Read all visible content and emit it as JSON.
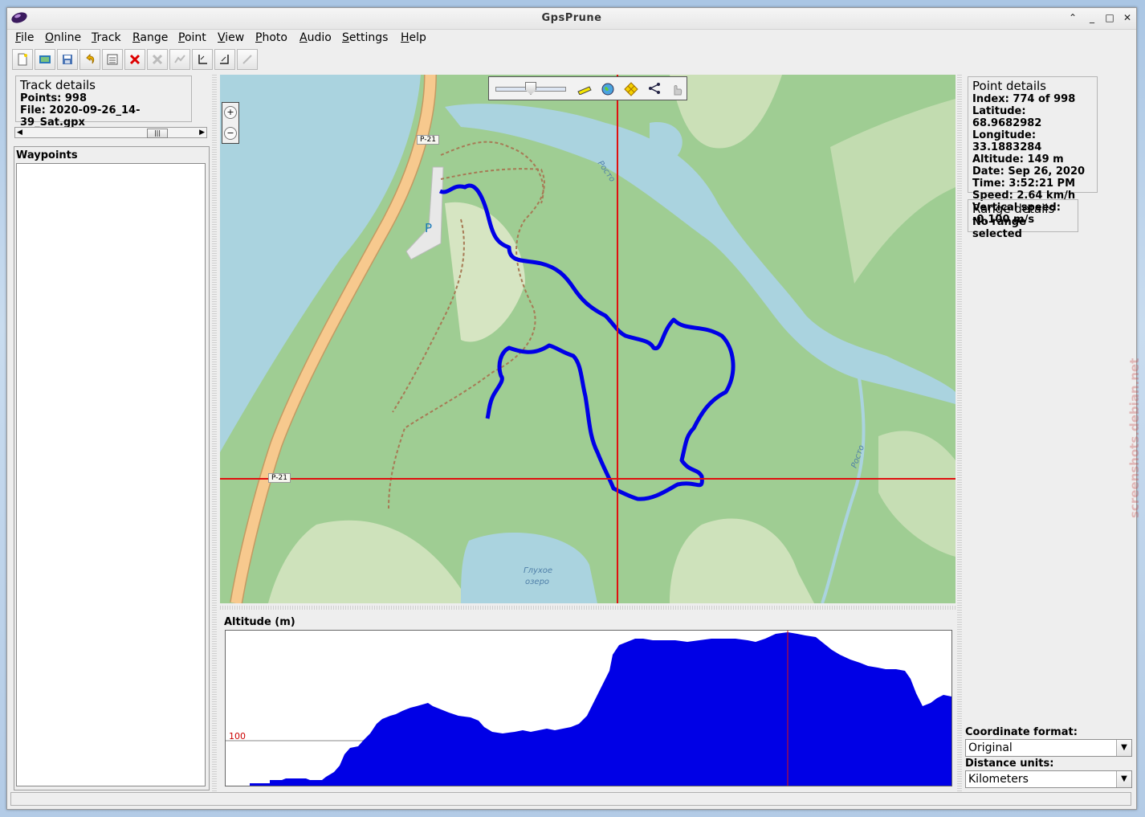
{
  "window": {
    "title": "GpsPrune"
  },
  "menu": [
    "File",
    "Online",
    "Track",
    "Range",
    "Point",
    "View",
    "Photo",
    "Audio",
    "Settings",
    "Help"
  ],
  "toolbar": {
    "icons": [
      "new-icon",
      "open-icon",
      "save-icon",
      "undo-icon",
      "edit-icon",
      "delete-icon",
      "delete-disabled-icon",
      "compress-icon",
      "range-start-icon",
      "range-end-icon",
      "connect-icon"
    ]
  },
  "track_details": {
    "title": "Track details",
    "points": "Points: 998",
    "file": "File: 2020-09-26_14-39_Sat.gpx"
  },
  "waypoints": {
    "title": "Waypoints"
  },
  "map": {
    "labels": {
      "road1": "P-21",
      "road2": "P-21",
      "river1": "Росто",
      "river2": "Росто",
      "lake_line1": "Глухое",
      "lake_line2": "озеро",
      "parking": "P"
    }
  },
  "altitude": {
    "label": "Altitude (m)",
    "tick": "100"
  },
  "point_details": {
    "title": "Point details",
    "index": "Index: 774 of 998",
    "latitude": "Latitude: 68.9682982",
    "longitude": "Longitude: 33.1883284",
    "altitude": "Altitude: 149 m",
    "date": "Date: Sep 26, 2020",
    "time": "Time: 3:52:21 PM",
    "speed": "Speed: 2.64 km/h",
    "vspeed": "Vertical speed: -0.100 m/s"
  },
  "range_details": {
    "title": "Range details",
    "value": "No range selected"
  },
  "coord_format": {
    "label": "Coordinate format:",
    "value": "Original"
  },
  "distance_units": {
    "label": "Distance units:",
    "value": "Kilometers"
  },
  "watermark": "screenshots.debian.net",
  "colors": {
    "track": "#0000e6",
    "crosshair": "#e01010",
    "water": "#aad3df",
    "forest": "#9fcd93",
    "road": "#f7c98e"
  }
}
